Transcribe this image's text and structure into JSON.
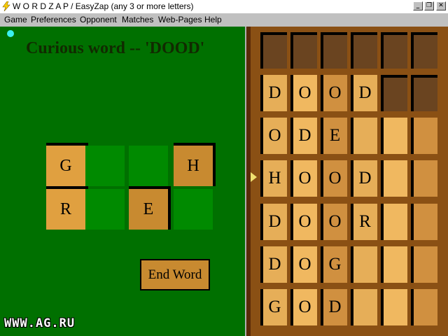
{
  "window": {
    "title": "W O R D Z A P / EasyZap (any 3 or more letters)"
  },
  "menu": [
    "Game",
    "Preferences",
    "Opponent",
    "Matches",
    "Web-Pages",
    "Help"
  ],
  "message": "Curious word -- 'DOOD'",
  "letter_rack": [
    [
      "G",
      "",
      "",
      "H"
    ],
    [
      "R",
      "",
      "E",
      ""
    ]
  ],
  "end_word_label": "End Word",
  "watermark": "WWW.AG.RU",
  "word_grid": [
    [
      "",
      "",
      "",
      "",
      "",
      ""
    ],
    [
      "D",
      "O",
      "O",
      "D",
      "",
      ""
    ],
    [
      "O",
      "D",
      "E",
      "",
      "",
      ""
    ],
    [
      "H",
      "O",
      "O",
      "D",
      "",
      ""
    ],
    [
      "D",
      "O",
      "O",
      "R",
      "",
      ""
    ],
    [
      "D",
      "O",
      "G",
      "",
      "",
      ""
    ],
    [
      "G",
      "O",
      "D",
      "",
      "",
      ""
    ]
  ]
}
